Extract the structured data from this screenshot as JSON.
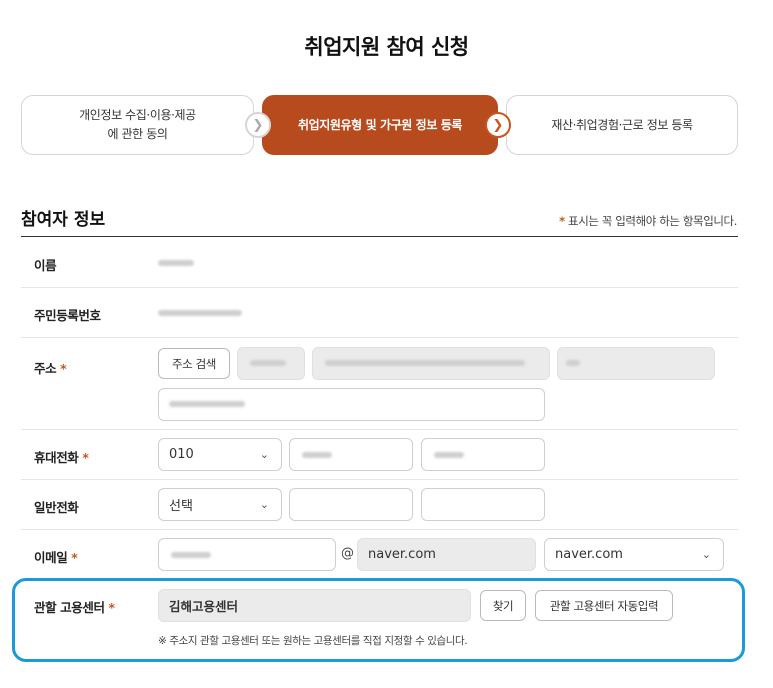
{
  "page": {
    "title": "취업지원 참여 신청"
  },
  "steps": [
    {
      "label_line1": "개인정보 수집·이용·제공",
      "label_line2": "에 관한 동의",
      "state": "done"
    },
    {
      "label": "취업지원유형 및 가구원 정보 등록",
      "state": "active"
    },
    {
      "label": "재산·취업경험·근로 정보 등록",
      "state": "pending"
    }
  ],
  "section": {
    "title": "참여자 정보",
    "required_star": "*",
    "required_note": "표시는 꼭 입력해야 하는 항목입니다."
  },
  "form": {
    "name": {
      "label": "이름"
    },
    "rrn": {
      "label": "주민등록번호"
    },
    "address": {
      "label": "주소",
      "search_button": "주소 검색"
    },
    "mobile": {
      "label": "휴대전화",
      "prefix": "010"
    },
    "phone": {
      "label": "일반전화",
      "prefix": "선택"
    },
    "email": {
      "label": "이메일",
      "at": "@",
      "domain": "naver.com",
      "domain_select": "naver.com"
    },
    "center": {
      "label": "관할 고용센터",
      "value": "김해고용센터",
      "find_button": "찾기",
      "auto_button": "관할 고용센터 자동입력",
      "hint": "※ 주소지 관할 고용센터 또는 원하는 고용센터를 직접 지정할 수 있습니다."
    }
  },
  "icons": {
    "step_arrow": "chevron-right-icon",
    "select_arrow": "chevron-down-icon"
  },
  "colors": {
    "accent": "#b84b1e",
    "highlight": "#1a9ad6"
  }
}
